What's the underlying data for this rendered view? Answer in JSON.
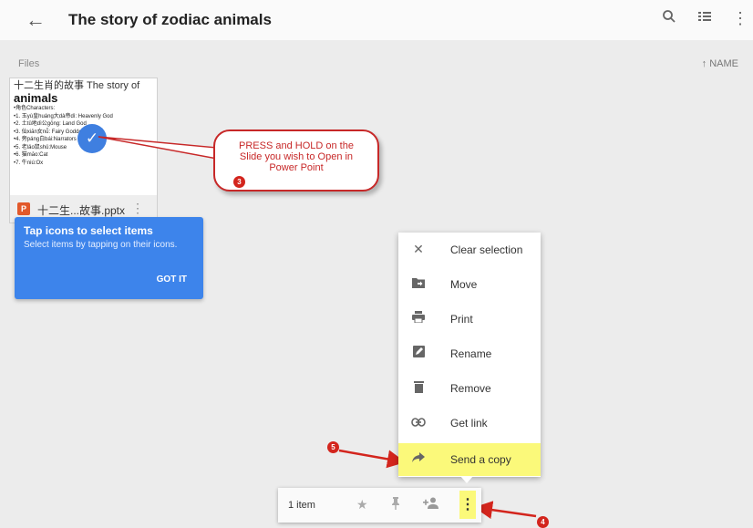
{
  "header": {
    "title": "The story of zodiac animals",
    "back_icon": "back-arrow-icon",
    "search_icon": "search-icon",
    "list_icon": "list-view-icon",
    "more_icon": "more-vertical-icon"
  },
  "files": {
    "section_label": "Files",
    "sort_label": "↑  NAME"
  },
  "card": {
    "slide_title_line1": "十二生肖的故事 The story of",
    "slide_title_line2": "animals",
    "slide_lines": [
      "•角色Characters:",
      "•1. 玉yù皇huáng大dà帝dì: Heavenly God",
      "•2. 土tǔ地dì公gōng: Land God",
      "•3. 仙xiān女nǚ: Fairy Goddess",
      "•4. 旁páng白bái:Narrators (two)",
      "•5. 老lǎo鼠shǔ:Mouse",
      "•6. 猫māo:Cat",
      "•7. 牛niú:Ox"
    ],
    "file_type": "P",
    "filename": "十二生...故事.pptx"
  },
  "tooltip": {
    "title": "Tap icons to select items",
    "body": "Select items by tapping on their icons.",
    "button": "GOT IT"
  },
  "annotation": {
    "callout_text": "PRESS and HOLD on the Slide you wish to Open in Power Point",
    "step3": "3",
    "step4": "4",
    "step5": "5",
    "accent_color": "#d3251d",
    "highlight_color": "#fbf97a"
  },
  "menu": {
    "items": [
      {
        "label": "Clear selection",
        "icon": "close-icon"
      },
      {
        "label": "Move",
        "icon": "move-folder-icon"
      },
      {
        "label": "Print",
        "icon": "print-icon"
      },
      {
        "label": "Rename",
        "icon": "rename-icon"
      },
      {
        "label": "Remove",
        "icon": "trash-icon"
      },
      {
        "label": "Get link",
        "icon": "link-icon"
      },
      {
        "label": "Send a copy",
        "icon": "share-arrow-icon"
      }
    ]
  },
  "action_bar": {
    "count": "1 item",
    "icons": [
      "star-icon",
      "pin-icon",
      "add-person-icon",
      "more-vertical-icon"
    ]
  }
}
